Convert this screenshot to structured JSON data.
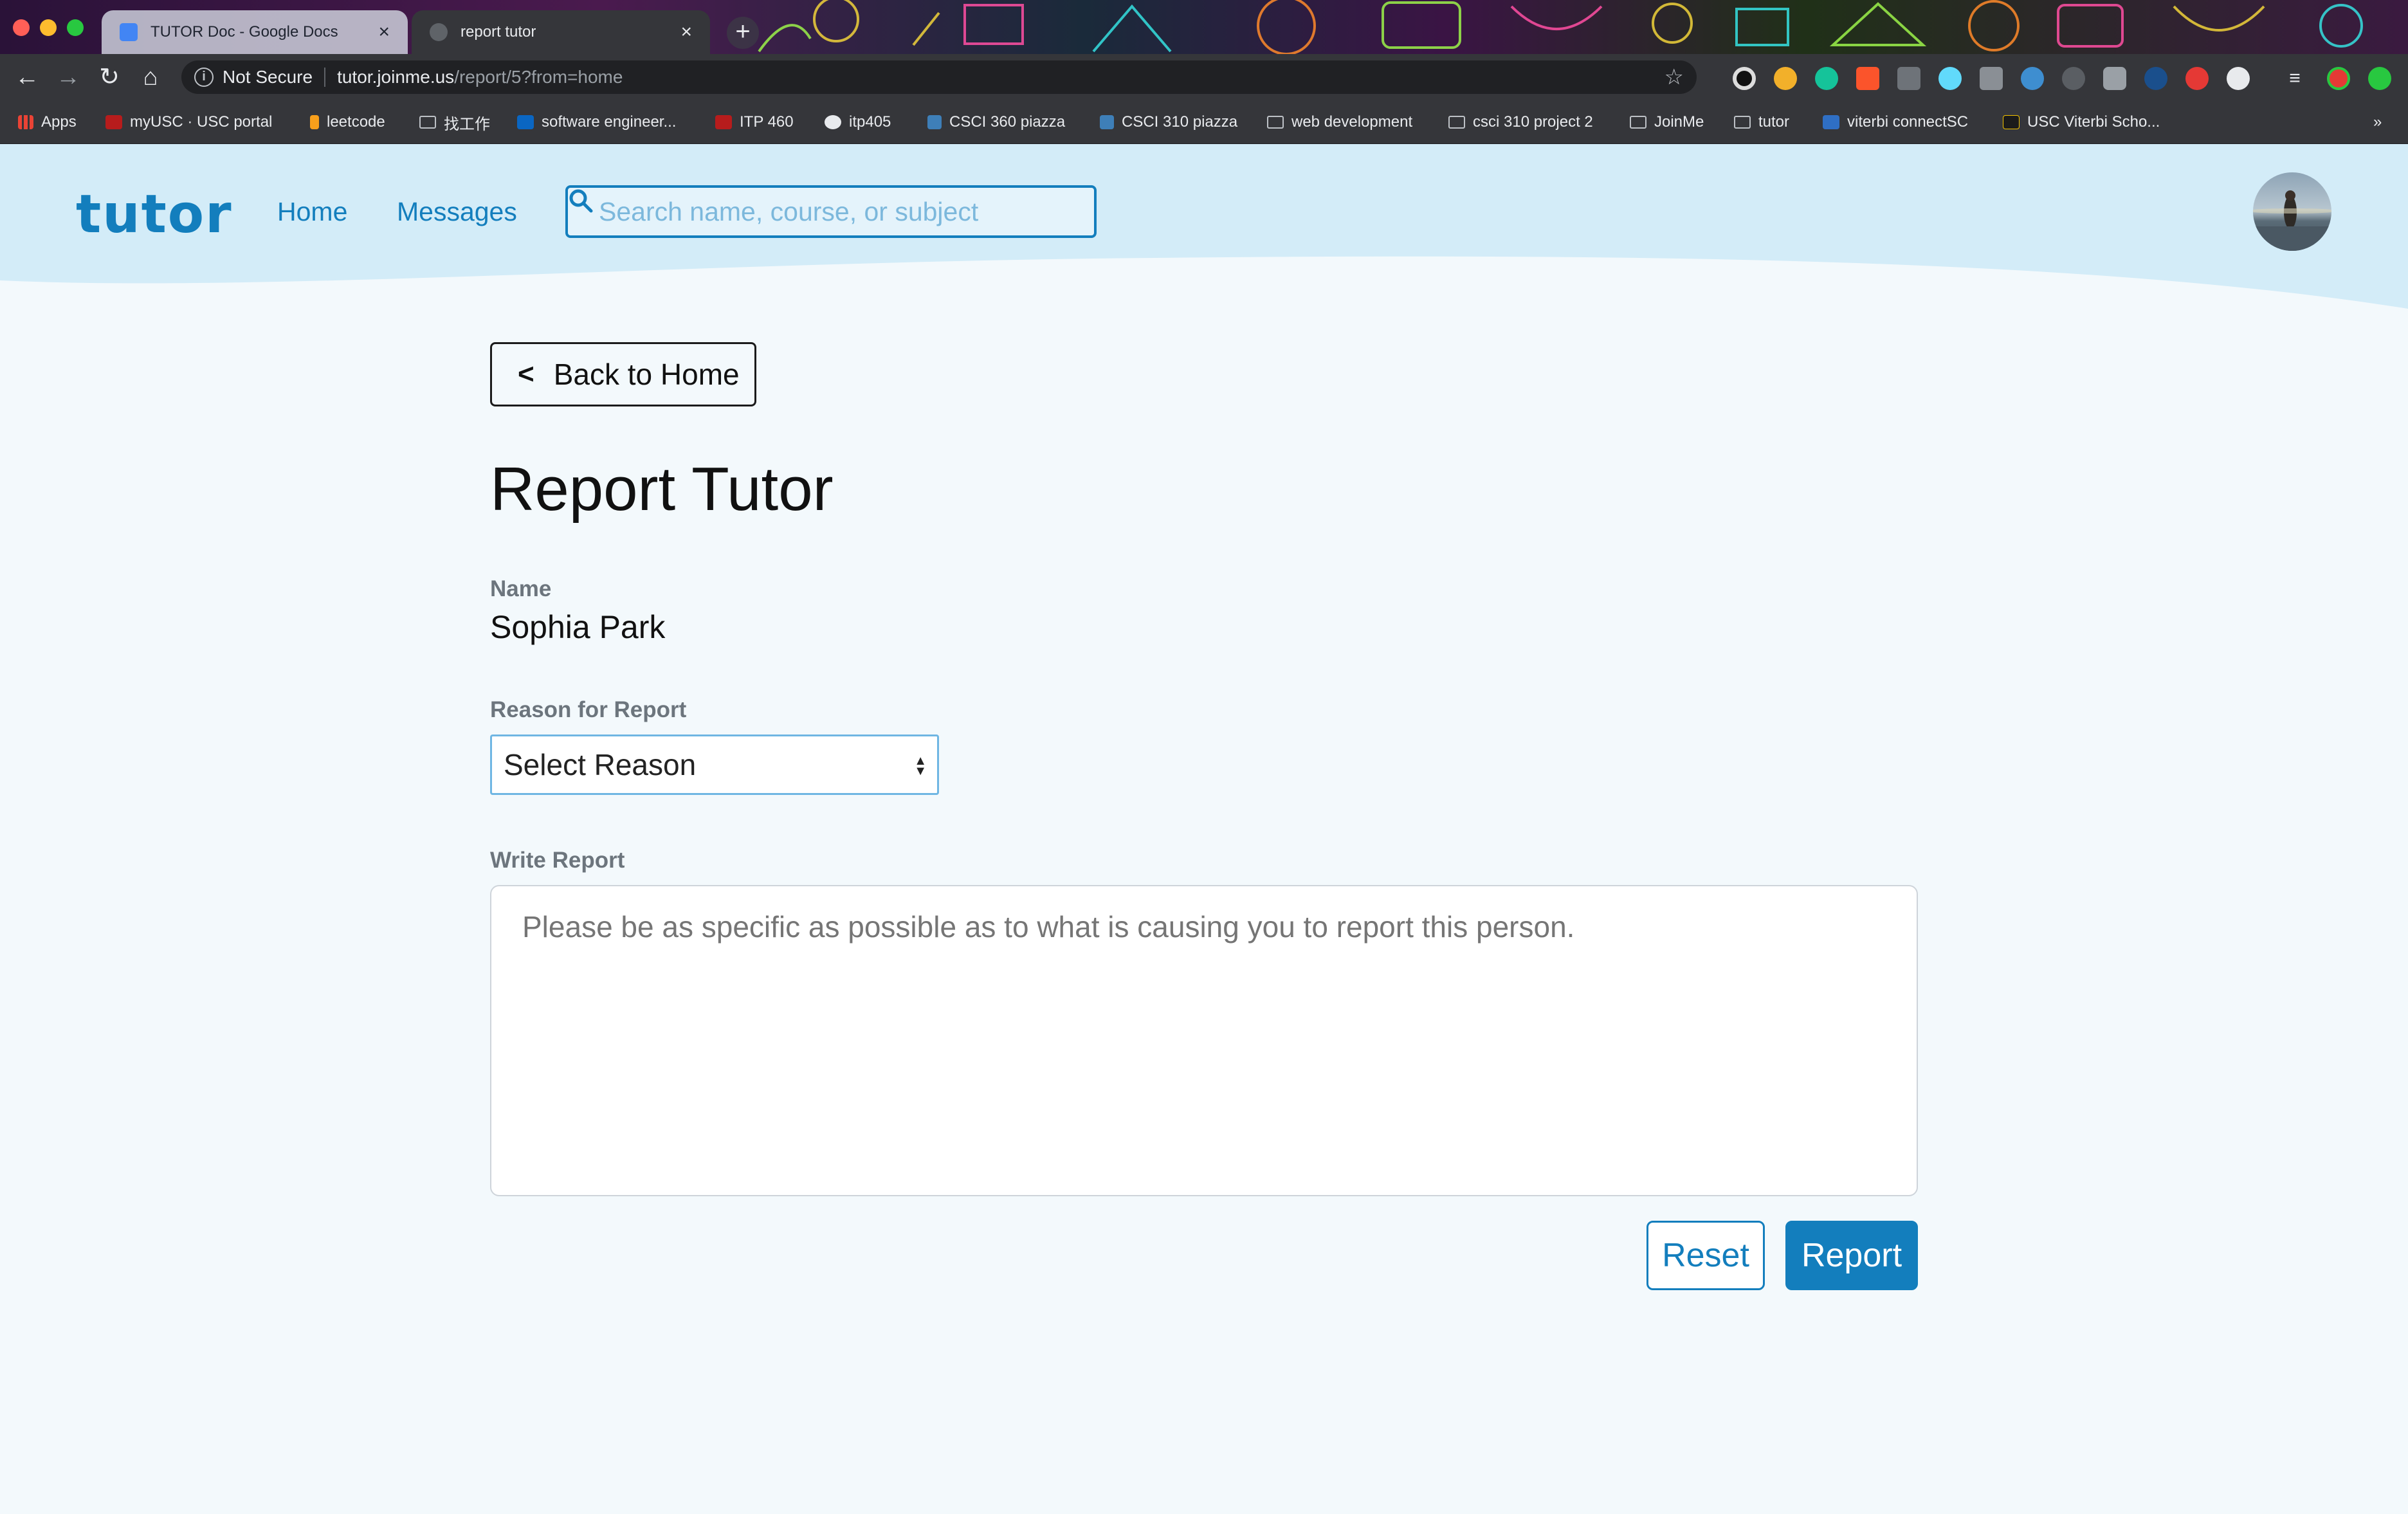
{
  "browser": {
    "tabs": [
      {
        "title": "TUTOR Doc - Google Docs",
        "active": false
      },
      {
        "title": "report tutor",
        "active": true
      }
    ],
    "address": {
      "security_label": "Not Secure",
      "host": "tutor.joinme.us",
      "path": "/report/5?from=home"
    },
    "bookmarks": [
      {
        "label": "Apps",
        "icon": "apps-grid-icon"
      },
      {
        "label": "myUSC · USC portal",
        "icon": "usc-icon"
      },
      {
        "label": "leetcode",
        "icon": "leetcode-icon"
      },
      {
        "label": "找工作",
        "icon": "folder-icon"
      },
      {
        "label": "software engineer...",
        "icon": "linkedin-icon"
      },
      {
        "label": "ITP 460",
        "icon": "usc-icon"
      },
      {
        "label": "itp405",
        "icon": "globe-icon"
      },
      {
        "label": "CSCI 360 piazza",
        "icon": "piazza-icon"
      },
      {
        "label": "CSCI 310 piazza",
        "icon": "piazza-icon"
      },
      {
        "label": "web development",
        "icon": "folder-icon"
      },
      {
        "label": "csci 310 project 2",
        "icon": "folder-icon"
      },
      {
        "label": "JoinMe",
        "icon": "folder-icon"
      },
      {
        "label": "tutor",
        "icon": "folder-icon"
      },
      {
        "label": "viterbi connectSC",
        "icon": "viterbi-icon"
      },
      {
        "label": "USC Viterbi Scho...",
        "icon": "usc-icon"
      }
    ],
    "more_bookmarks": "»"
  },
  "app": {
    "logo": "tutor",
    "nav": {
      "home": "Home",
      "messages": "Messages"
    },
    "search_placeholder": "Search name, course, or subject"
  },
  "report": {
    "back_label": "Back to Home",
    "title": "Report Tutor",
    "name_label": "Name",
    "name_value": "Sophia Park",
    "reason_label": "Reason for Report",
    "reason_selected": "Select Reason",
    "write_label": "Write Report",
    "write_placeholder": "Please be as specific as possible as to what is causing you to report this person.",
    "reset_label": "Reset",
    "report_label": "Report"
  },
  "colors": {
    "brand": "#137ebd",
    "hero_bg": "#d3ecf8",
    "page_bg": "#f3f9fc"
  }
}
